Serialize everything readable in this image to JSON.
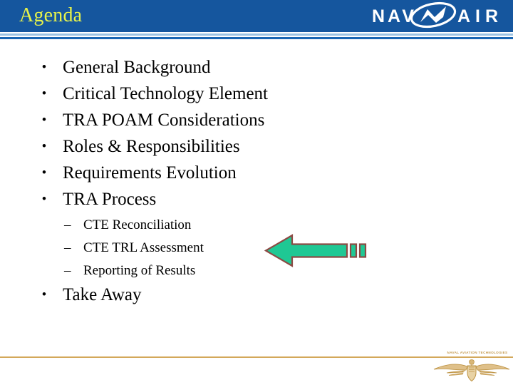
{
  "header": {
    "title": "Agenda",
    "title_color": "#E6F24B",
    "bar_color": "#15569E",
    "logo": {
      "text_left": "NAV",
      "text_right": "AIR",
      "icon": "navair-swoosh-jet-icon",
      "color": "#FFFFFF"
    }
  },
  "agenda": {
    "bullet_marker": "•",
    "items": [
      {
        "label": "General Background"
      },
      {
        "label": "Critical Technology Element"
      },
      {
        "label": "TRA POAM Considerations"
      },
      {
        "label": "Roles & Responsibilities"
      },
      {
        "label": "Requirements Evolution"
      },
      {
        "label": "TRA Process"
      }
    ],
    "sub_marker": "–",
    "sub_items": [
      {
        "label": "CTE Reconciliation"
      },
      {
        "label": "CTE TRL Assessment"
      },
      {
        "label": "Reporting of Results"
      }
    ],
    "final_item": {
      "label": "Take Away"
    }
  },
  "callout": {
    "name": "green-left-arrow",
    "direction": "left",
    "fill_color": "#1FC894",
    "outline_color": "#8C4A44",
    "tail_segments": 2
  },
  "footer": {
    "brand_text": "NAVAL AVIATION TECHNOLOGIES",
    "rule_color": "#D3A85A",
    "emblem": "naval-aviator-wings-icon",
    "emblem_color": "#C49A4E"
  }
}
